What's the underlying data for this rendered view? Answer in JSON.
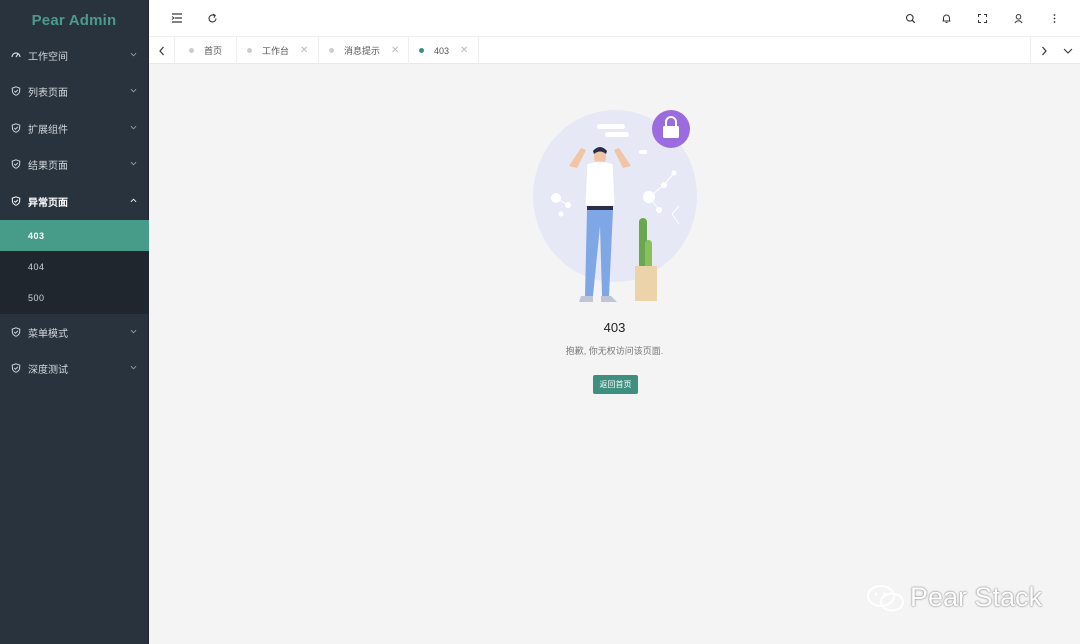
{
  "app": {
    "title": "Pear Admin"
  },
  "sidebar": {
    "items": [
      {
        "label": "工作空间",
        "icon": "dashboard-icon"
      },
      {
        "label": "列表页面",
        "icon": "shield-icon"
      },
      {
        "label": "扩展组件",
        "icon": "shield-icon"
      },
      {
        "label": "结果页面",
        "icon": "shield-icon"
      },
      {
        "label": "异常页面",
        "icon": "shield-icon"
      },
      {
        "label": "菜单模式",
        "icon": "shield-icon"
      },
      {
        "label": "深度测试",
        "icon": "shield-icon"
      }
    ],
    "submenu": [
      {
        "label": "403"
      },
      {
        "label": "404"
      },
      {
        "label": "500"
      }
    ],
    "active_submenu": "403"
  },
  "tabs": [
    {
      "label": "首页",
      "closable": false
    },
    {
      "label": "工作台",
      "closable": true
    },
    {
      "label": "消息提示",
      "closable": true
    },
    {
      "label": "403",
      "closable": true,
      "active": true
    }
  ],
  "error": {
    "code": "403",
    "message": "抱歉, 你无权访问该页面.",
    "button": "返回首页"
  },
  "watermark": {
    "text": "Pear Stack"
  },
  "colors": {
    "accent": "#469c89",
    "sidebar": "#28333e",
    "logo": "#4e9a8b"
  }
}
